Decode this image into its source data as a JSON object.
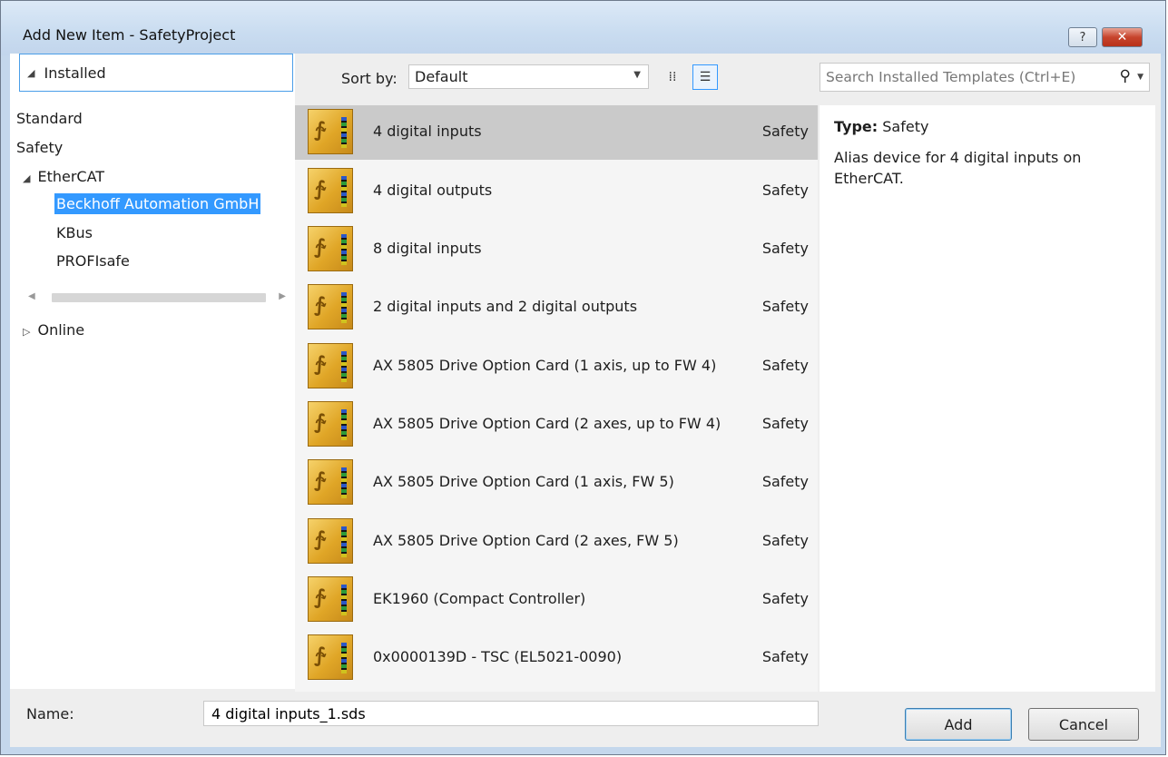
{
  "window": {
    "title": "Add New Item - SafetyProject",
    "help_label": "?",
    "close_label": "✕"
  },
  "tree": {
    "installed_label": "Installed",
    "items": [
      {
        "label": "Standard"
      },
      {
        "label": "Safety"
      },
      {
        "label": "EtherCAT"
      },
      {
        "label": "Beckhoff Automation GmbH"
      },
      {
        "label": "KBus"
      },
      {
        "label": "PROFIsafe"
      },
      {
        "label": "Online"
      }
    ]
  },
  "sort": {
    "label": "Sort by:",
    "value": "Default"
  },
  "search": {
    "placeholder": "Search Installed Templates (Ctrl+E)"
  },
  "templates": [
    {
      "name": "4 digital inputs",
      "category": "Safety"
    },
    {
      "name": "4 digital outputs",
      "category": "Safety"
    },
    {
      "name": "8 digital inputs",
      "category": "Safety"
    },
    {
      "name": "2 digital inputs and 2 digital outputs",
      "category": "Safety"
    },
    {
      "name": "AX 5805 Drive Option Card (1 axis, up to FW 4)",
      "category": "Safety"
    },
    {
      "name": "AX 5805 Drive Option Card (2 axes, up to FW 4)",
      "category": "Safety"
    },
    {
      "name": "AX 5805 Drive Option Card (1 axis, FW 5)",
      "category": "Safety"
    },
    {
      "name": "AX 5805 Drive Option Card (2 axes, FW 5)",
      "category": "Safety"
    },
    {
      "name": "EK1960 (Compact Controller)",
      "category": "Safety"
    },
    {
      "name": "0x0000139D - TSC (EL5021-0090)",
      "category": "Safety"
    }
  ],
  "details": {
    "type_label": "Type:",
    "type_value": "Safety",
    "description": "Alias device for 4 digital inputs on EtherCAT."
  },
  "footer": {
    "name_label": "Name:",
    "name_value": "4 digital inputs_1.sds",
    "add_label": "Add",
    "cancel_label": "Cancel"
  },
  "colors": {
    "selection": "#3399ff",
    "selected_row": "#cacaca",
    "window_frame": "#c4d7ec",
    "close_button": "#c7442c"
  },
  "icons": {
    "template": "safety-device-icon",
    "search": "magnifier-icon"
  }
}
